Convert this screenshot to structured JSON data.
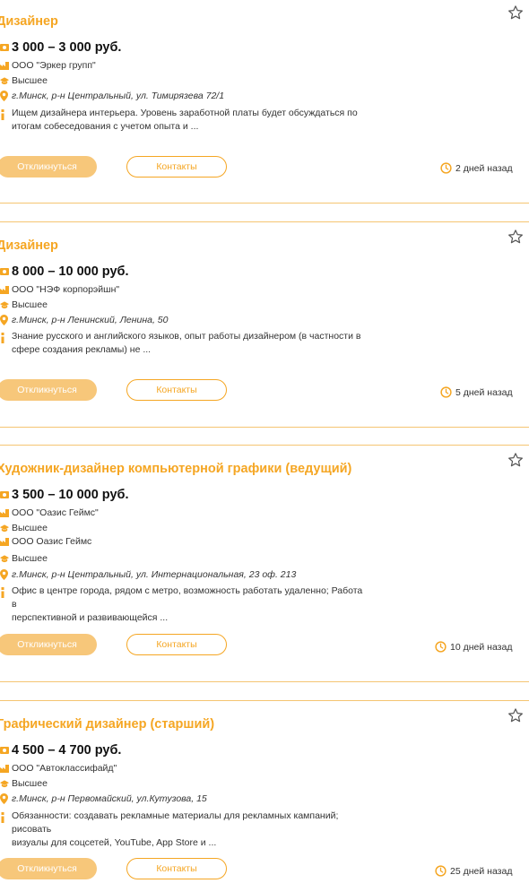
{
  "cards": [
    {
      "title": "Дизайнер",
      "salary": "3 000 – 3 000 руб.",
      "company": "ООО \"Эркер групп\"",
      "education": "Высшее",
      "address": "г.Минск, р-н Центральный, ул. Тимирязева 72/1",
      "description_line1": "Ищем дизайнера интерьера. Уровень заработной платы будет обсуждаться по",
      "description_line2": "итогам собеседования с учетом опыта и ...",
      "apply_label": "Откликнуться",
      "contacts_label": "Контакты",
      "posted": "2 дней назад"
    },
    {
      "title": "Дизайнер",
      "salary": "8 000 – 10 000 руб.",
      "company": "ООО \"НЭФ корпорэйшн\"",
      "education": "Высшее",
      "address": "г.Минск, р-н Ленинский, Ленина, 50",
      "description_line1": "Знание русского и английского языков, опыт работы дизайнером (в частности в",
      "description_line2": "сфере создания рекламы) не ...",
      "apply_label": "Откликнуться",
      "contacts_label": "Контакты",
      "posted": "5 дней назад"
    },
    {
      "title": "Художник-дизайнер компьютерной графики (ведущий)",
      "salary": "3 500 – 10 000 руб.",
      "company": "ООО \"Оазис Геймс\"",
      "education": "Высшее",
      "ghost_company": "ООО  Оазис Геймс",
      "education_repeat": "Высшее",
      "address": "г.Минск, р-н Центральный, ул. Интернациональная, 23 оф. 213",
      "description_line1": "Офис в центре города, рядом с метро, возможность работать удаленно; Работа в",
      "description_line2": "перспективной и развивающейся ...",
      "apply_label": "Откликнуться",
      "contacts_label": "Контакты",
      "posted": "10 дней назад"
    },
    {
      "title": "Графический дизайнер (старший)",
      "salary": "4 500 – 4 700 руб.",
      "company": "ООО \"Автоклассифайд\"",
      "education": "Высшее",
      "address": "г.Минск, р-н Первомайский, ул.Кутузова, 15",
      "description_line1": "Обязанности: создавать рекламные материалы для рекламных кампаний; рисовать",
      "description_line2": "визуалы для соцсетей, YouTube, App Store и ...",
      "apply_label": "Откликнуться",
      "contacts_label": "Контакты",
      "posted": "25 дней назад"
    }
  ],
  "icons": {
    "star": "star-outline-icon",
    "salary": "banknote-icon",
    "company": "building-icon",
    "education": "graduation-cap-icon",
    "address": "map-pin-icon",
    "description": "info-icon",
    "posted": "clock-icon"
  },
  "colors": {
    "accent": "#f5a623",
    "apply_button": "#f7c77a",
    "separator": "#f5c572"
  }
}
